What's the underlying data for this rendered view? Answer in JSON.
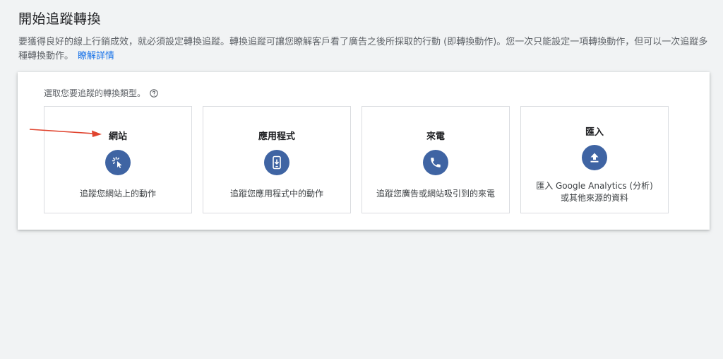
{
  "header": {
    "title": "開始追蹤轉換",
    "description": "要獲得良好的線上行銷成效，就必須設定轉換追蹤。轉換追蹤可讓您瞭解客戶看了廣告之後所採取的行動 (即轉換動作)。您一次只能設定一項轉換動作，但可以一次追蹤多種轉換動作。",
    "learn_more": "瞭解詳情"
  },
  "selector": {
    "prompt": "選取您要追蹤的轉換類型。",
    "help_icon": "help-circle-icon",
    "options": [
      {
        "title": "網站",
        "description": "追蹤您網站上的動作",
        "icon": "click-cursor-icon"
      },
      {
        "title": "應用程式",
        "description": "追蹤您應用程式中的動作",
        "icon": "phone-download-icon"
      },
      {
        "title": "來電",
        "description": "追蹤您廣告或網站吸引到的來電",
        "icon": "phone-call-icon"
      },
      {
        "title": "匯入",
        "description": "匯入 Google Analytics (分析) 或其他來源的資料",
        "icon": "upload-icon"
      }
    ]
  },
  "annotation": {
    "icon": "red-arrow-icon",
    "color": "#e0442f"
  },
  "colors": {
    "icon_background": "#3f64a3",
    "link": "#1a73e8",
    "page_background": "#f1f3f4"
  }
}
